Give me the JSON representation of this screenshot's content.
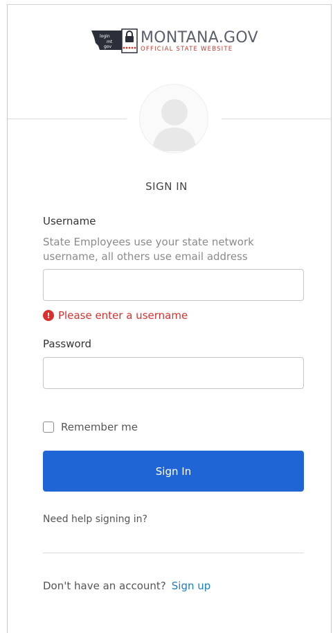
{
  "logo": {
    "badge_text": "login mt gov",
    "title": "MONTANA.GOV",
    "subtitle": "OFFICIAL STATE WEBSITE",
    "icon": "lock-icon"
  },
  "avatar": {
    "icon": "user-silhouette-icon"
  },
  "heading": "SIGN IN",
  "username": {
    "label": "Username",
    "hint": "State Employees use your state network username, all others use email address",
    "value": "",
    "placeholder": "",
    "error": "Please enter a username",
    "error_icon": "error-icon"
  },
  "password": {
    "label": "Password",
    "value": "",
    "placeholder": ""
  },
  "remember": {
    "label": "Remember me",
    "checked": false
  },
  "signin_button": "Sign In",
  "help_link": "Need help signing in?",
  "signup": {
    "prompt": "Don't have an account?",
    "link": "Sign up"
  },
  "colors": {
    "primary_button": "#1f65d6",
    "error": "#d9302e",
    "link": "#1a7fbf"
  }
}
